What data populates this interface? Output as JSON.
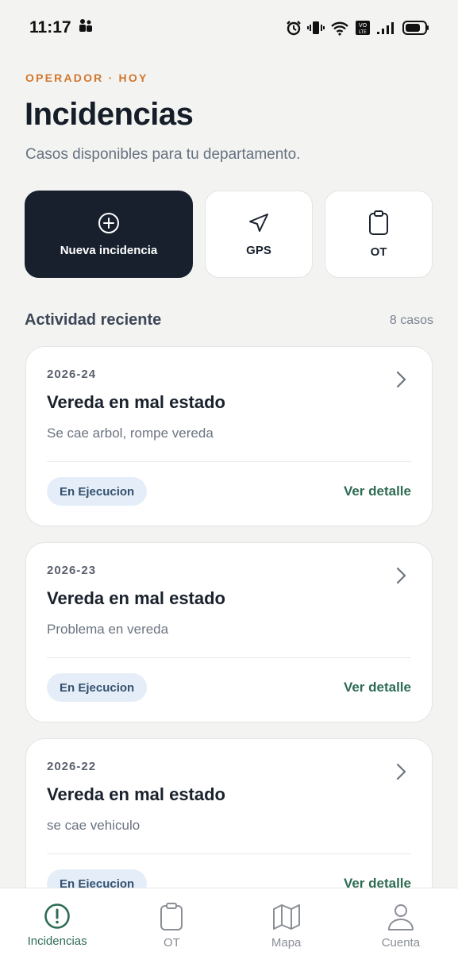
{
  "status_bar": {
    "time": "11:17"
  },
  "header": {
    "eyebrow": "OPERADOR · HOY",
    "title": "Incidencias",
    "subtitle": "Casos disponibles para tu departamento."
  },
  "actions": [
    {
      "label": "Nueva incidencia",
      "icon": "plus-circle-icon",
      "primary": true
    },
    {
      "label": "GPS",
      "icon": "navigation-arrow-icon",
      "primary": false
    },
    {
      "label": "OT",
      "icon": "clipboard-icon",
      "primary": false
    }
  ],
  "activity": {
    "title": "Actividad reciente",
    "count": "8 casos"
  },
  "cards": [
    {
      "code": "2026-24",
      "title": "Vereda en mal estado",
      "description": "Se cae arbol, rompe vereda",
      "status": "En Ejecucion",
      "link": "Ver detalle"
    },
    {
      "code": "2026-23",
      "title": "Vereda en mal estado",
      "description": "Problema en vereda",
      "status": "En Ejecucion",
      "link": "Ver detalle"
    },
    {
      "code": "2026-22",
      "title": "Vereda en mal estado",
      "description": "se cae vehiculo",
      "status": "En Ejecucion",
      "link": "Ver detalle"
    }
  ],
  "bottom_nav": [
    {
      "label": "Incidencias",
      "icon": "alert-circle-icon",
      "active": true
    },
    {
      "label": "OT",
      "icon": "clipboard-icon",
      "active": false
    },
    {
      "label": "Mapa",
      "icon": "map-icon",
      "active": false
    },
    {
      "label": "Cuenta",
      "icon": "user-icon",
      "active": false
    }
  ],
  "colors": {
    "accent_orange": "#d2762d",
    "primary_dark": "#17202c",
    "link_green": "#2e6b53",
    "badge_bg": "#e5eef8",
    "background": "#f3f4f2"
  }
}
